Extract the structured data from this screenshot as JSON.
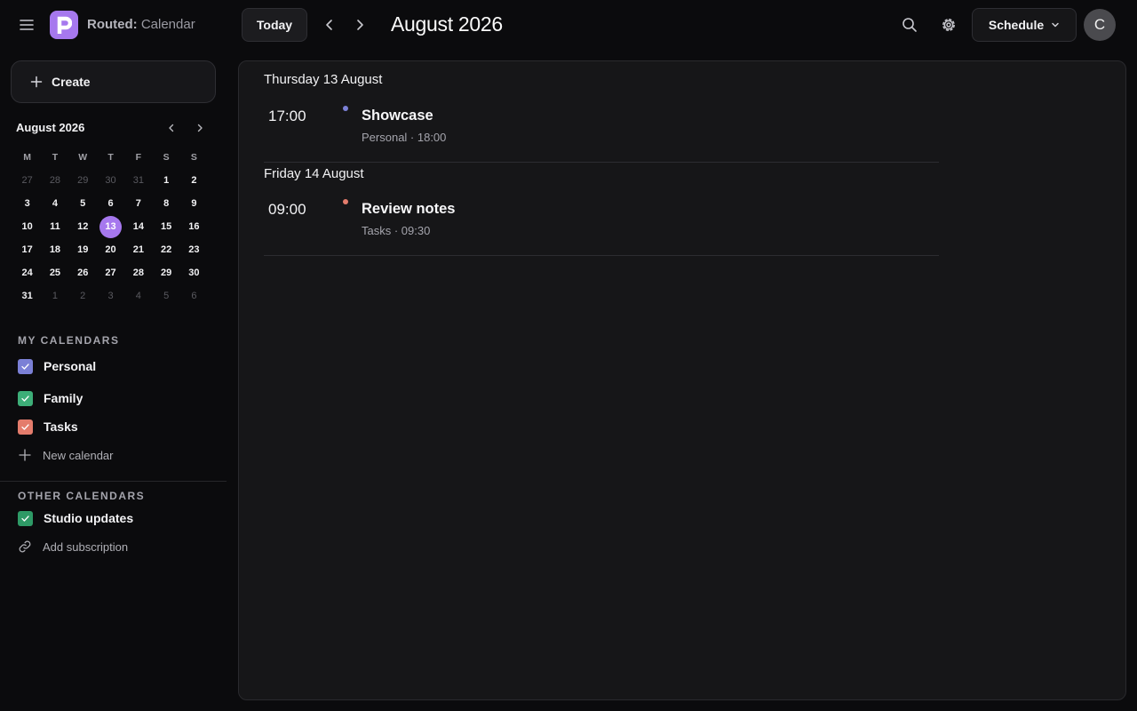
{
  "app": {
    "name_bold": "Routed:",
    "name_rest": " Calendar",
    "logo_color": "#a678ee"
  },
  "header": {
    "today_label": "Today",
    "month_title": "August 2026",
    "view_label": "Schedule",
    "avatar_initial": "C",
    "icons": [
      "menu-icon",
      "chevron-left-icon",
      "chevron-right-icon",
      "search-icon",
      "gear-icon",
      "chevron-down-icon"
    ]
  },
  "sidebar": {
    "create_label": "Create",
    "mini_calendar": {
      "title": "August 2026",
      "weekdays": [
        "M",
        "T",
        "W",
        "T",
        "F",
        "S",
        "S"
      ],
      "weeks": [
        [
          {
            "d": "27",
            "m": true
          },
          {
            "d": "28",
            "m": true
          },
          {
            "d": "29",
            "m": true
          },
          {
            "d": "30",
            "m": true
          },
          {
            "d": "31",
            "m": true
          },
          {
            "d": "1"
          },
          {
            "d": "2"
          }
        ],
        [
          {
            "d": "3"
          },
          {
            "d": "4"
          },
          {
            "d": "5"
          },
          {
            "d": "6"
          },
          {
            "d": "7"
          },
          {
            "d": "8"
          },
          {
            "d": "9"
          }
        ],
        [
          {
            "d": "10"
          },
          {
            "d": "11"
          },
          {
            "d": "12"
          },
          {
            "d": "13",
            "sel": true
          },
          {
            "d": "14"
          },
          {
            "d": "15"
          },
          {
            "d": "16"
          }
        ],
        [
          {
            "d": "17"
          },
          {
            "d": "18"
          },
          {
            "d": "19"
          },
          {
            "d": "20"
          },
          {
            "d": "21"
          },
          {
            "d": "22"
          },
          {
            "d": "23"
          }
        ],
        [
          {
            "d": "24"
          },
          {
            "d": "25"
          },
          {
            "d": "26"
          },
          {
            "d": "27"
          },
          {
            "d": "28"
          },
          {
            "d": "29"
          },
          {
            "d": "30"
          }
        ],
        [
          {
            "d": "31"
          },
          {
            "d": "1",
            "m": true
          },
          {
            "d": "2",
            "m": true
          },
          {
            "d": "3",
            "m": true
          },
          {
            "d": "4",
            "m": true
          },
          {
            "d": "5",
            "m": true
          },
          {
            "d": "6",
            "m": true
          }
        ]
      ]
    },
    "my_calendars": {
      "title": "MY CALENDARS",
      "items": [
        {
          "label": "Personal",
          "color": "#7b80d6",
          "checked": true
        },
        {
          "label": "Family",
          "color": "#3dae78",
          "checked": true
        },
        {
          "label": "Tasks",
          "color": "#e47c6c",
          "checked": true
        }
      ],
      "add_label": "New calendar"
    },
    "other_calendars": {
      "title": "OTHER CALENDARS",
      "items": [
        {
          "label": "Studio updates",
          "color": "#2e9a66",
          "checked": true
        }
      ],
      "add_label": "Add subscription"
    }
  },
  "schedule": {
    "days": [
      {
        "heading": "Thursday 13 August",
        "events": [
          {
            "time": "17:00",
            "title": "Showcase",
            "meta": "Personal · 18:00",
            "color": "#7b80d6"
          }
        ]
      },
      {
        "heading": "Friday 14 August",
        "events": [
          {
            "time": "09:00",
            "title": "Review notes",
            "meta": "Tasks · 09:30",
            "color": "#e47c6c"
          }
        ]
      }
    ]
  }
}
